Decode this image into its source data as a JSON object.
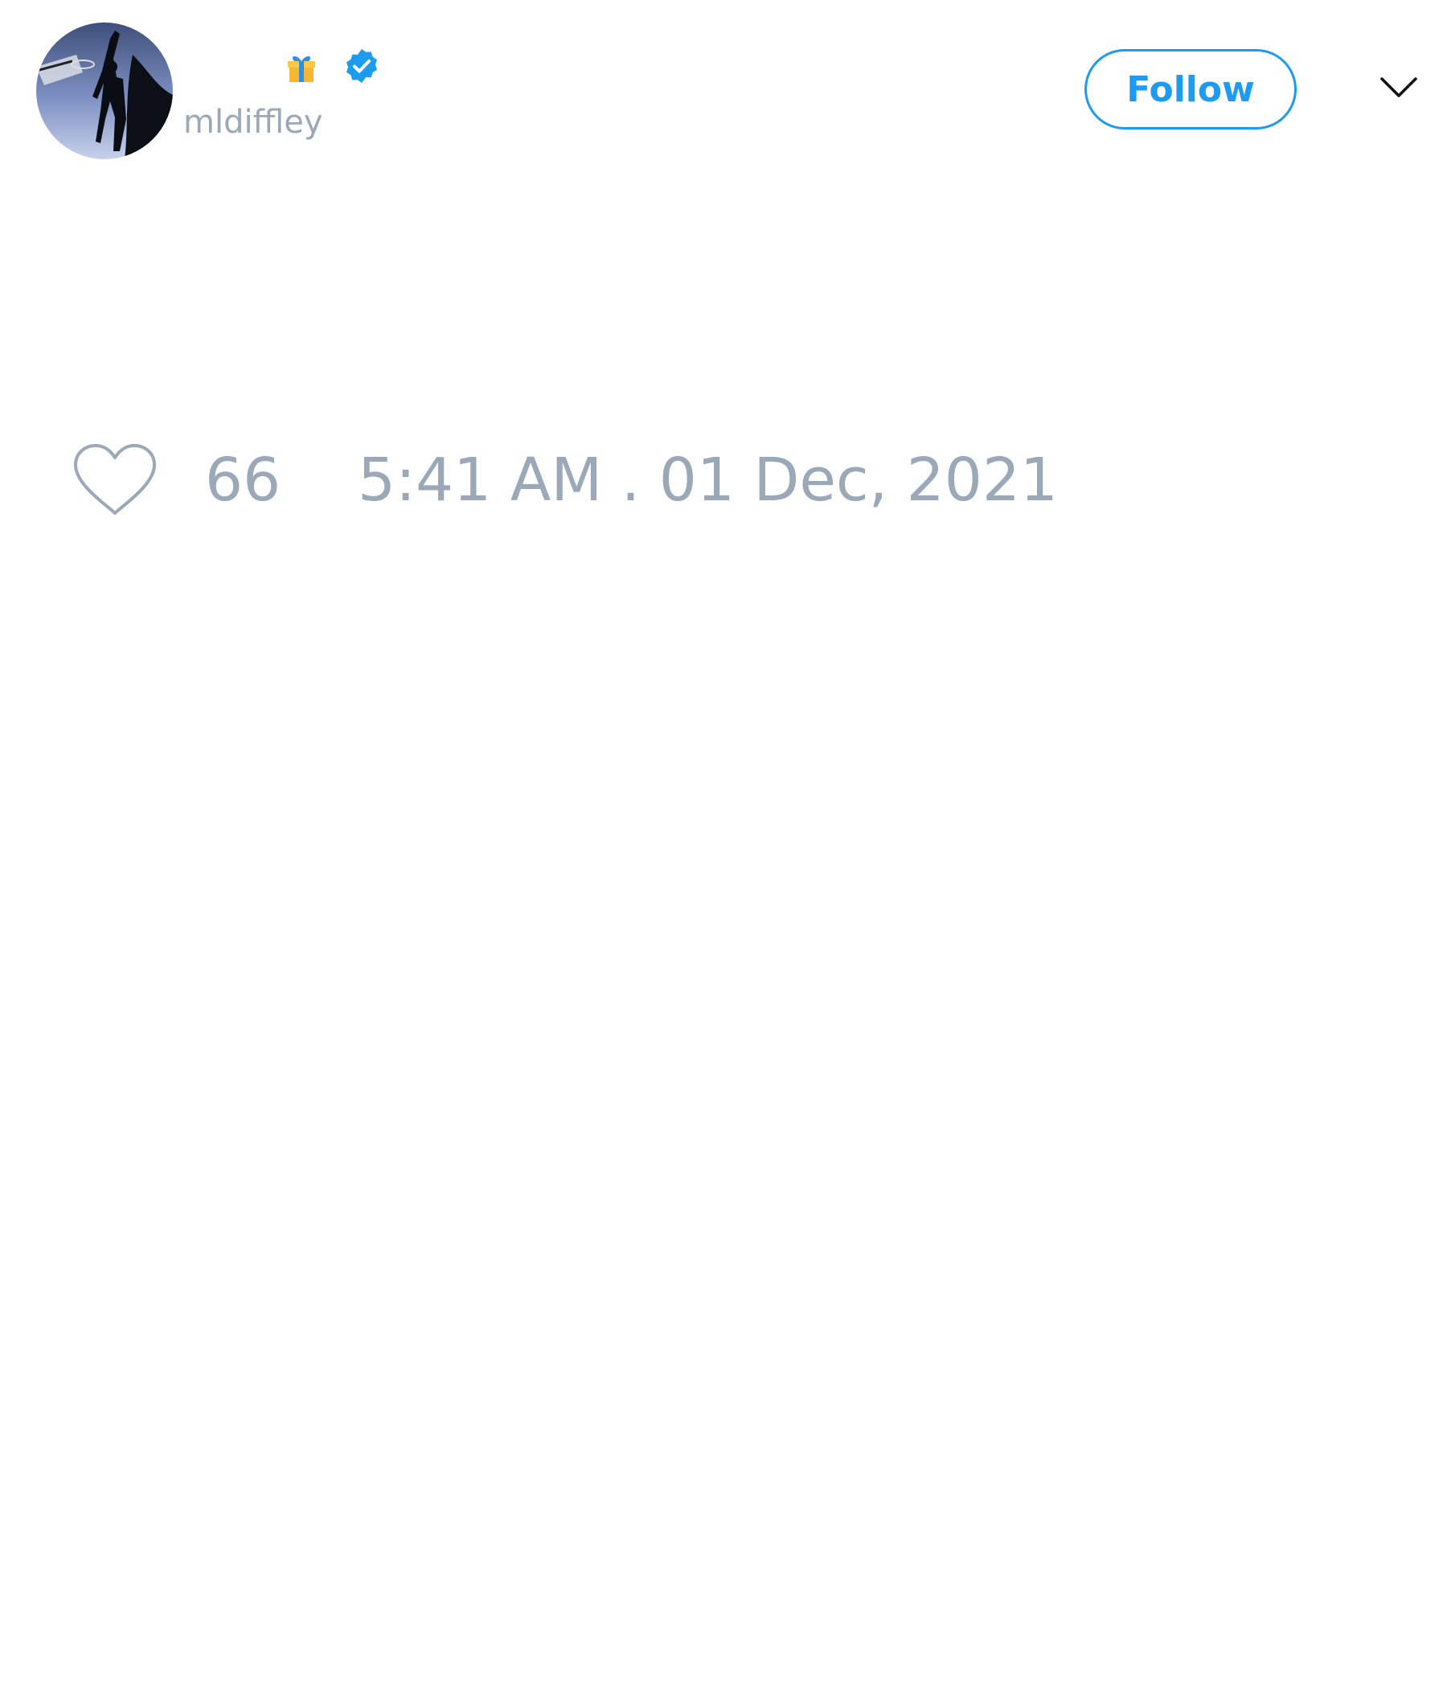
{
  "tweet": {
    "author": {
      "handle": "mldiffley",
      "avatar": "avatar-basketball-silhouette",
      "badges": [
        "gift-icon",
        "verified-badge-icon"
      ]
    },
    "follow_label": "Follow",
    "menu_icon": "chevron-down-icon",
    "like_icon": "heart-icon",
    "like_count": "66",
    "timestamp": "5:41 AM . 01 Dec, 2021"
  },
  "colors": {
    "accent": "#1d9bf0",
    "muted_text": "#9aa8b8",
    "background": "#ffffff"
  }
}
